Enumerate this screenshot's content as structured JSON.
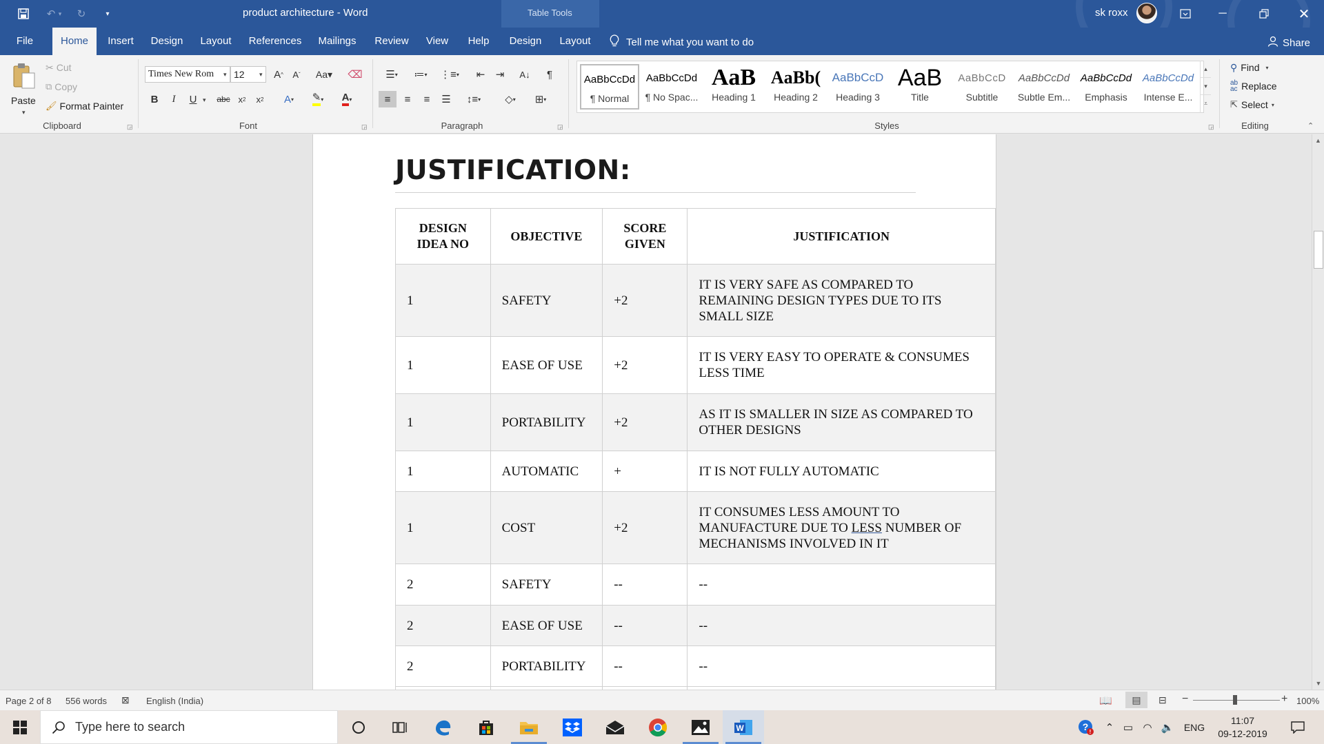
{
  "window": {
    "title": "product architecture  -  Word",
    "context_tab_group": "Table Tools",
    "user_name": "sk roxx"
  },
  "ribbon_tabs": [
    "File",
    "Home",
    "Insert",
    "Design",
    "Layout",
    "References",
    "Mailings",
    "Review",
    "View",
    "Help",
    "Design",
    "Layout"
  ],
  "active_tab": "Home",
  "tell_me": "Tell me what you want to do",
  "share": "Share",
  "clipboard": {
    "paste": "Paste",
    "cut": "Cut",
    "copy": "Copy",
    "format_painter": "Format Painter",
    "label": "Clipboard"
  },
  "font": {
    "name": "Times New Rom",
    "size": "12",
    "label": "Font"
  },
  "paragraph": {
    "label": "Paragraph"
  },
  "styles": {
    "label": "Styles",
    "items": [
      {
        "sample": "AaBbCcDd",
        "name": "¶ Normal"
      },
      {
        "sample": "AaBbCcDd",
        "name": "¶ No Spac..."
      },
      {
        "sample": "AaB",
        "name": "Heading 1"
      },
      {
        "sample": "AaBb(",
        "name": "Heading 2"
      },
      {
        "sample": "AaBbCcD",
        "name": "Heading 3"
      },
      {
        "sample": "AaB",
        "name": "Title"
      },
      {
        "sample": "AaBbCcD",
        "name": "Subtitle"
      },
      {
        "sample": "AaBbCcDd",
        "name": "Subtle Em..."
      },
      {
        "sample": "AaBbCcDd",
        "name": "Emphasis"
      },
      {
        "sample": "AaBbCcDd",
        "name": "Intense E..."
      }
    ]
  },
  "editing": {
    "find": "Find",
    "replace": "Replace",
    "select": "Select",
    "label": "Editing"
  },
  "document": {
    "heading": "JUSTIFICATION:",
    "table": {
      "headers": [
        "DESIGN IDEA NO",
        "OBJECTIVE",
        "SCORE GIVEN",
        "JUSTIFICATION"
      ],
      "rows": [
        [
          "1",
          "SAFETY",
          "+2",
          "IT IS VERY SAFE AS COMPARED TO REMAINING DESIGN TYPES DUE TO ITS SMALL SIZE"
        ],
        [
          "1",
          "EASE OF USE",
          "+2",
          "IT IS VERY EASY TO OPERATE & CONSUMES LESS TIME"
        ],
        [
          "1",
          "PORTABILITY",
          "+2",
          "AS IT IS SMALLER IN SIZE AS COMPARED TO OTHER DESIGNS"
        ],
        [
          "1",
          "AUTOMATIC",
          "+",
          "IT IS NOT FULLY AUTOMATIC"
        ],
        [
          "1",
          "COST",
          "+2",
          "IT CONSUMES LESS AMOUNT TO MANUFACTURE DUE TO LESS NUMBER OF MECHANISMS INVOLVED IN IT"
        ],
        [
          "2",
          "SAFETY",
          "--",
          "--"
        ],
        [
          "2",
          "EASE OF USE",
          "--",
          "--"
        ],
        [
          "2",
          "PORTABILITY",
          "--",
          "--"
        ]
      ]
    }
  },
  "status": {
    "page": "Page 2 of 8",
    "words": "556 words",
    "language": "English (India)",
    "zoom": "100%"
  },
  "taskbar": {
    "search_placeholder": "Type here to search",
    "lang": "ENG",
    "time": "11:07",
    "date": "09-12-2019"
  },
  "colors": {
    "word_blue": "#2b579a",
    "ribbon_bg": "#f3f3f3",
    "taskbar_bg": "#e9e1db"
  }
}
